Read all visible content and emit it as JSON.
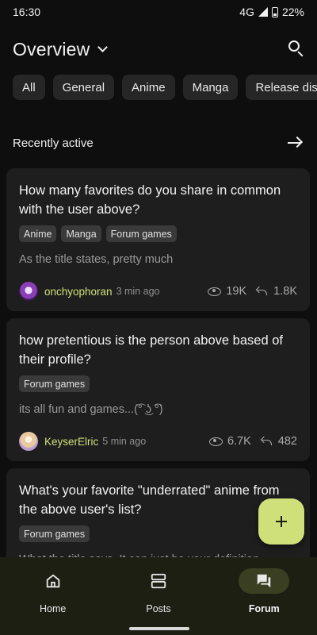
{
  "status": {
    "time": "16:30",
    "network": "4G",
    "battery": "22%"
  },
  "header": {
    "title": "Overview"
  },
  "chips": [
    "All",
    "General",
    "Anime",
    "Manga",
    "Release disc"
  ],
  "section": {
    "title": "Recently active"
  },
  "posts": [
    {
      "title": "How many favorites do you share in common with the user above?",
      "tags": [
        "Anime",
        "Manga",
        "Forum games"
      ],
      "excerpt": "As the title states, pretty much",
      "author": "onchyophoran",
      "time": "3 min ago",
      "views": "19K",
      "replies": "1.8K"
    },
    {
      "title": "how pretentious is the person above based of their profile?",
      "tags": [
        "Forum games"
      ],
      "excerpt": "its all fun and games...(͡° ͜ʖ ͡°)",
      "author": "KeyserElric",
      "time": "5 min ago",
      "views": "6.7K",
      "replies": "482"
    },
    {
      "title": "What's your favorite \"underrated\" anime from the above user's list?",
      "tags": [
        "Forum games"
      ],
      "excerpt": "What the title says. It can just be your definition"
    }
  ],
  "nav": [
    {
      "label": "Home",
      "icon": "home-icon"
    },
    {
      "label": "Posts",
      "icon": "posts-icon"
    },
    {
      "label": "Forum",
      "icon": "forum-icon",
      "active": true
    }
  ],
  "colors": {
    "accent": "#cfe07a",
    "background": "#0e0e0e",
    "card": "#1e1e1e",
    "nav": "#1d1f13"
  }
}
